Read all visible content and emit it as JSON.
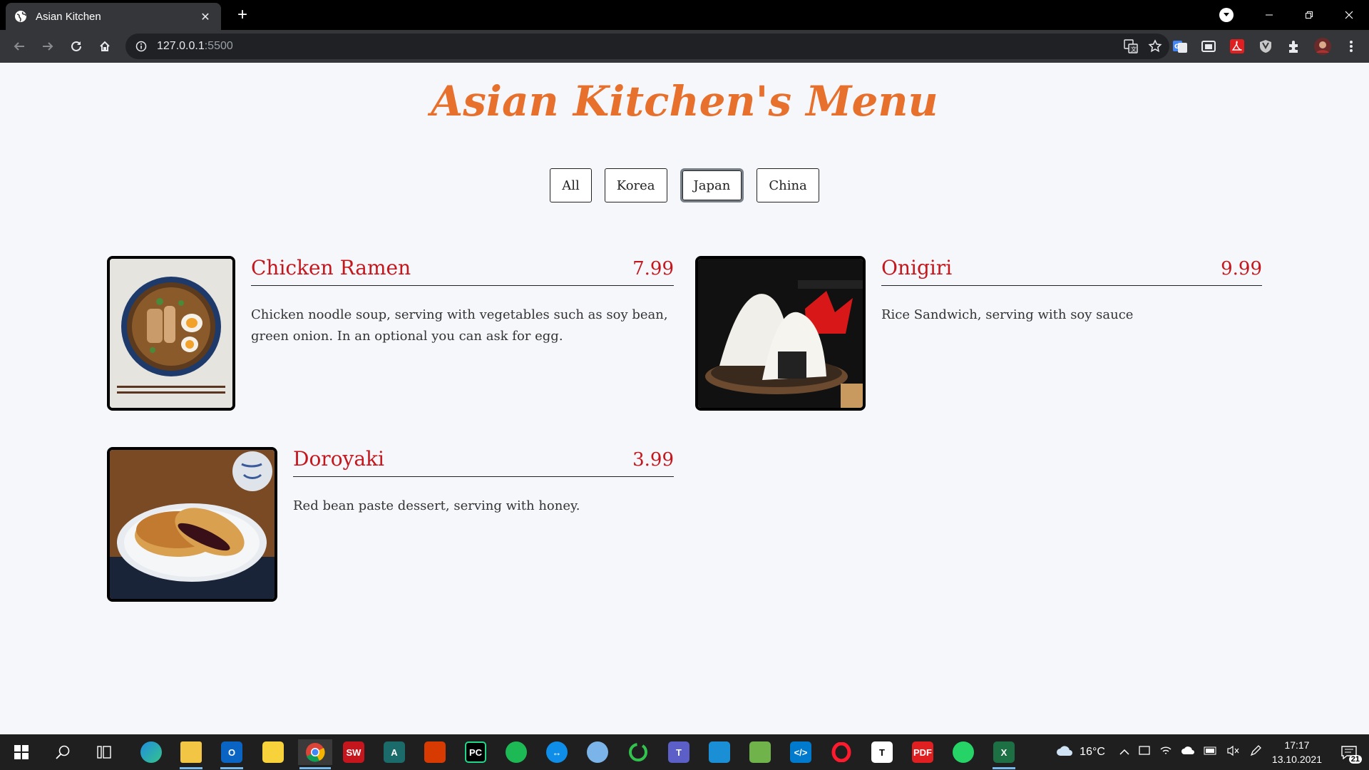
{
  "browser": {
    "tab_title": "Asian Kitchen",
    "url_host": "127.0.0.1",
    "url_port": ":5500"
  },
  "page": {
    "title": "Asian Kitchen's Menu",
    "filters": [
      "All",
      "Korea",
      "Japan",
      "China"
    ],
    "active_filter": "Japan",
    "accent_title_color": "#e8702d",
    "accent_item_color": "#c4171d",
    "items": [
      {
        "name": "Chicken Ramen",
        "price": "7.99",
        "description": "Chicken noodle soup, serving with vegetables such as soy bean, green onion. In an optional you can ask for egg."
      },
      {
        "name": "Onigiri",
        "price": "9.99",
        "description": "Rice Sandwich, serving with soy sauce"
      },
      {
        "name": "Doroyaki",
        "price": "3.99",
        "description": "Red bean paste dessert, serving with honey."
      }
    ]
  },
  "taskbar": {
    "temperature": "16°C",
    "time": "17:17",
    "date": "13.10.2021",
    "notification_count": "21",
    "apps": [
      "windows-start",
      "search",
      "task-view",
      "edge",
      "file-explorer",
      "outlook",
      "sticky-notes",
      "chrome",
      "solidworks",
      "adobe",
      "office",
      "pycharm",
      "spotify",
      "teamviewer",
      "paint",
      "cycle",
      "teams",
      "onedrive-sync",
      "notepad",
      "vscode",
      "opera",
      "typora",
      "pdf",
      "whatsapp",
      "excel"
    ]
  }
}
